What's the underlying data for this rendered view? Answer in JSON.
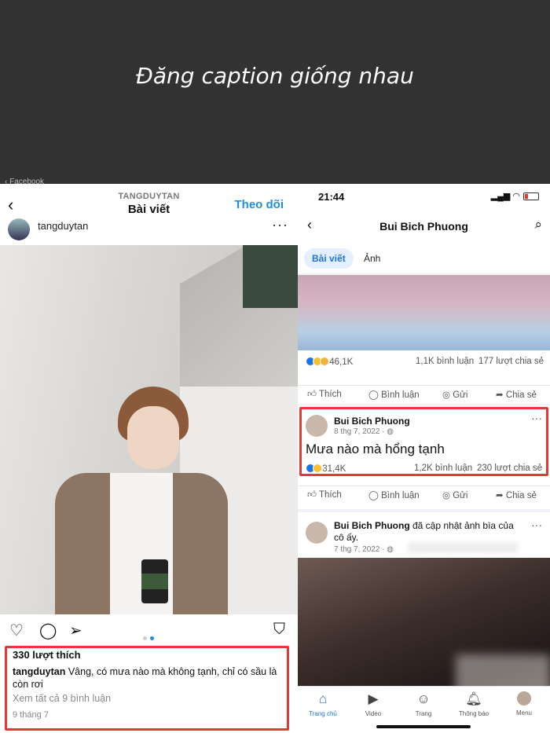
{
  "banner": {
    "title": "Đăng caption giống nhau",
    "cutoff_text": "‹ Facebook"
  },
  "instagram": {
    "header_sub": "TANGDUYTAN",
    "header_title": "Bài viết",
    "follow_label": "Theo dõi",
    "username": "tangduytan",
    "likes": "330 lượt thích",
    "caption_user": "tangduytan",
    "caption_text": "Vâng, có mưa nào mà không tạnh, chỉ có sầu là còn rơi",
    "view_comments": "Xem tất cả 9 bình luận",
    "date": "9 tháng 7"
  },
  "facebook": {
    "time": "21:44",
    "page_title": "Bui Bich Phuong",
    "tabs": [
      "Bài viết",
      "Ảnh"
    ],
    "post1": {
      "reactions": "46,1K",
      "comments": "1,1K bình luận",
      "shares": "177 lượt chia sẻ"
    },
    "actions": [
      "Thích",
      "Bình luận",
      "Gửi",
      "Chia sẻ"
    ],
    "post2": {
      "author": "Bui Bich Phuong",
      "date": "8 thg 7, 2022 · ◍",
      "text": "Mưa nào mà hổng tạnh",
      "reactions": "31,4K",
      "comments": "1,2K bình luận",
      "shares": "230 lượt chia sẻ"
    },
    "post3": {
      "author": "Bui Bich Phuong",
      "action": "đã cập nhật ảnh bìa của cô ấy.",
      "date": "7 thg 7, 2022 · ◍"
    },
    "nav": [
      "Trang chủ",
      "Video",
      "Trang",
      "Thông báo",
      "Menu"
    ]
  },
  "colors": {
    "accent_blue": "#1b74e4",
    "ig_blue": "#1d8fe0",
    "highlight_red": "#e53935"
  }
}
